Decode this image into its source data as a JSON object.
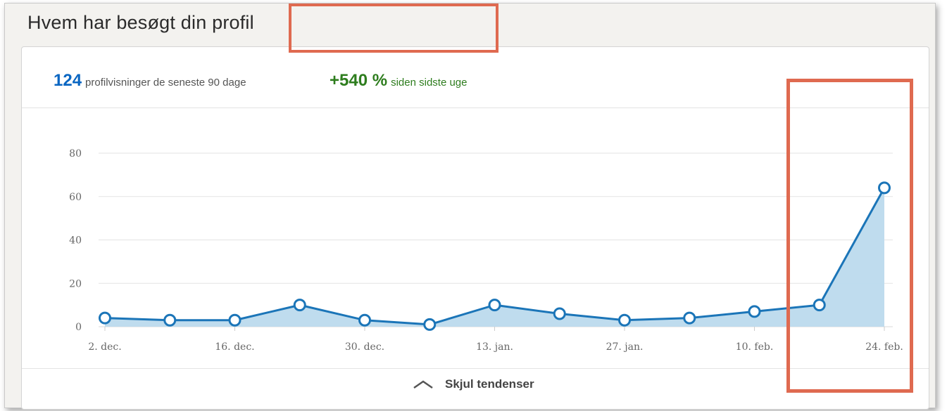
{
  "header": {
    "title": "Hvem har besøgt din profil"
  },
  "stats": {
    "views_count": "124",
    "views_label": "profilvisninger de seneste 90 dage",
    "change_value": "+540 %",
    "change_label": "siden sidste uge"
  },
  "footer": {
    "toggle_label": "Skjul tendenser",
    "toggle_icon": "chevron-up-icon"
  },
  "colors": {
    "accent": "#0a66c2",
    "line": "#1b75b8",
    "area": "#bcdaed",
    "positive": "#2e7d1e",
    "highlight": "#df6a50"
  },
  "chart_data": {
    "type": "area",
    "title": "",
    "xlabel": "",
    "ylabel": "",
    "ylim": [
      0,
      80
    ],
    "yticks": [
      0,
      20,
      40,
      60,
      80
    ],
    "xtick_labels": [
      "2. dec.",
      "16. dec.",
      "30. dec.",
      "13. jan.",
      "27. jan.",
      "10. feb.",
      "24. feb."
    ],
    "x": [
      "2. dec.",
      "9. dec.",
      "16. dec.",
      "23. dec.",
      "30. dec.",
      "6. jan.",
      "13. jan.",
      "20. jan.",
      "27. jan.",
      "3. feb.",
      "10. feb.",
      "17. feb.",
      "24. feb."
    ],
    "values": [
      4,
      3,
      3,
      10,
      3,
      1,
      10,
      6,
      3,
      4,
      7,
      10,
      64
    ],
    "grid": true,
    "legend": "none"
  }
}
